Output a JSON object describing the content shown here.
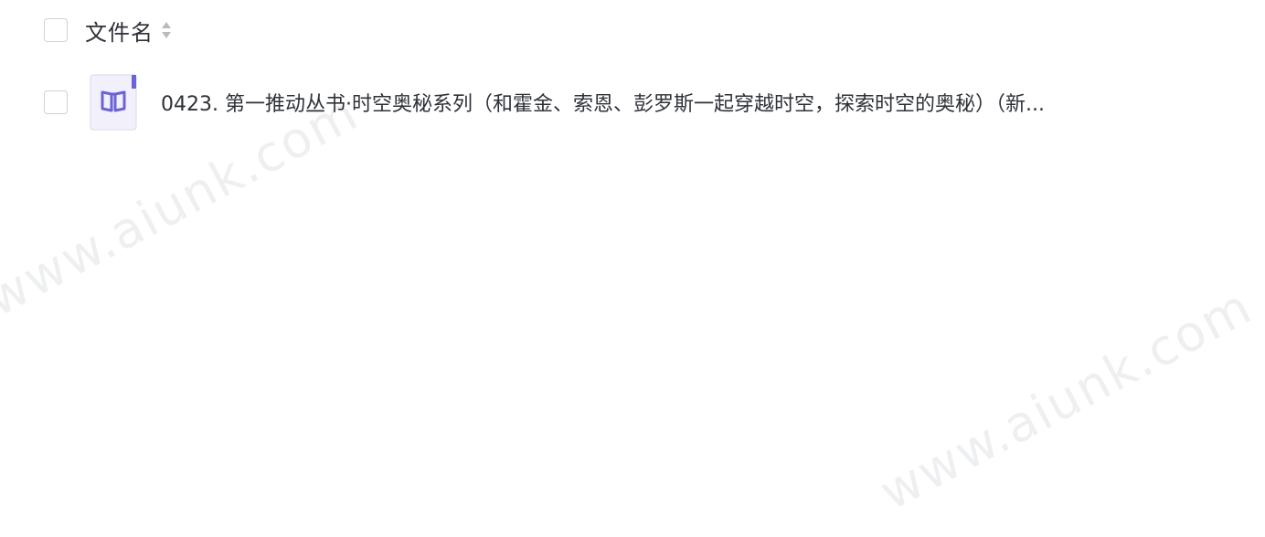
{
  "table": {
    "header": {
      "column_title": "文件名",
      "sort_icon": "sort-caret-icon"
    },
    "rows": [
      {
        "icon": "book-file-icon",
        "name": "0423. 第一推动丛书·时空奥秘系列（和霍金、索恩、彭罗斯一起穿越时空，探索时空的奥秘）（新..."
      }
    ]
  },
  "watermark": {
    "text": "www.aiunk.com"
  },
  "colors": {
    "icon_accent": "#6b63d6",
    "icon_bg": "#f1f0fb",
    "checkbox_border": "#cfd1d6"
  }
}
